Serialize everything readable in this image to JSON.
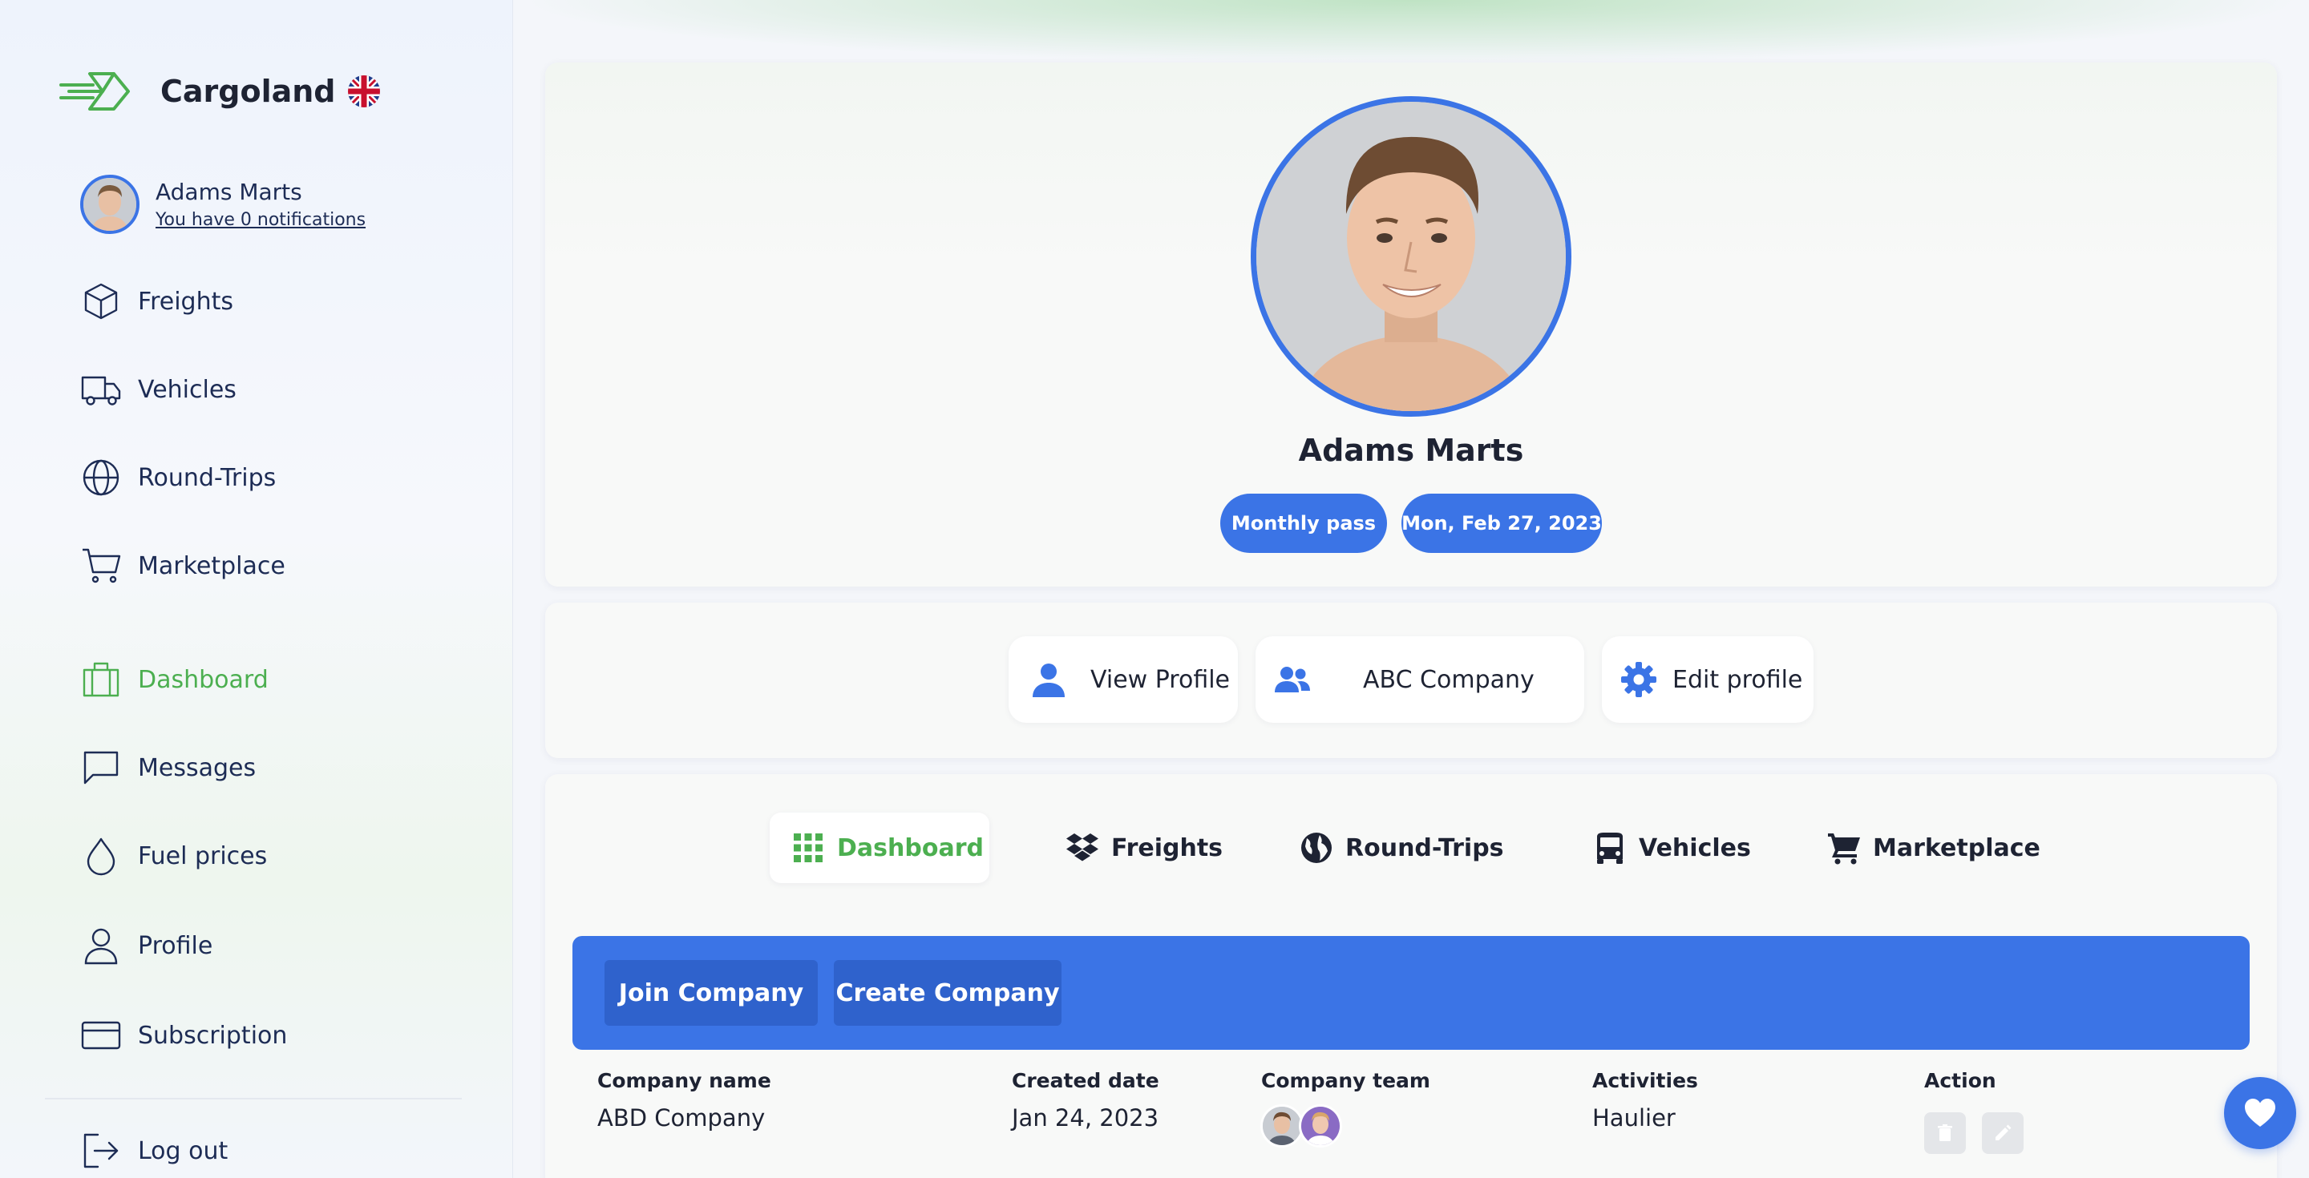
{
  "brand": {
    "name": "Cargoland",
    "logo_icon": "cargoland-logo-icon",
    "language_icon": "uk-flag-icon"
  },
  "user": {
    "name": "Adams Marts",
    "notifications": "You have 0 notifications"
  },
  "sidebar": {
    "items": [
      {
        "label": "Freights",
        "icon": "box-icon"
      },
      {
        "label": "Vehicles",
        "icon": "truck-icon"
      },
      {
        "label": "Round-Trips",
        "icon": "globe-icon"
      },
      {
        "label": "Marketplace",
        "icon": "cart-icon"
      },
      {
        "label": "Dashboard",
        "icon": "briefcase-icon",
        "active": true
      },
      {
        "label": "Messages",
        "icon": "message-icon"
      },
      {
        "label": "Fuel prices",
        "icon": "drop-icon"
      },
      {
        "label": "Profile",
        "icon": "user-icon"
      },
      {
        "label": "Subscription",
        "icon": "credit-card-icon"
      },
      {
        "label": "Log out",
        "icon": "logout-icon"
      }
    ]
  },
  "profile": {
    "name": "Adams Marts",
    "pass": "Monthly pass",
    "date": "Mon, Feb 27, 2023"
  },
  "actions": {
    "view_profile": "View Profile",
    "company": "ABC Company",
    "edit_profile": "Edit profile"
  },
  "tabs": [
    {
      "label": "Dashboard",
      "icon": "grid-icon",
      "active": true
    },
    {
      "label": "Freights",
      "icon": "dropbox-icon"
    },
    {
      "label": "Round-Trips",
      "icon": "globe-icon"
    },
    {
      "label": "Vehicles",
      "icon": "bus-icon"
    },
    {
      "label": "Marketplace",
      "icon": "cart-icon"
    }
  ],
  "company_bar": {
    "join": "Join Company",
    "create": "Create Company"
  },
  "table": {
    "headers": [
      "Company name",
      "Created date",
      "Company team",
      "Activities",
      "Action"
    ],
    "rows": [
      {
        "name": "ABD Company",
        "created": "Jan 24, 2023",
        "activities": "Haulier"
      }
    ]
  },
  "colors": {
    "accent": "#3b74e6",
    "active": "#4caf50",
    "text": "#1d2c55"
  }
}
